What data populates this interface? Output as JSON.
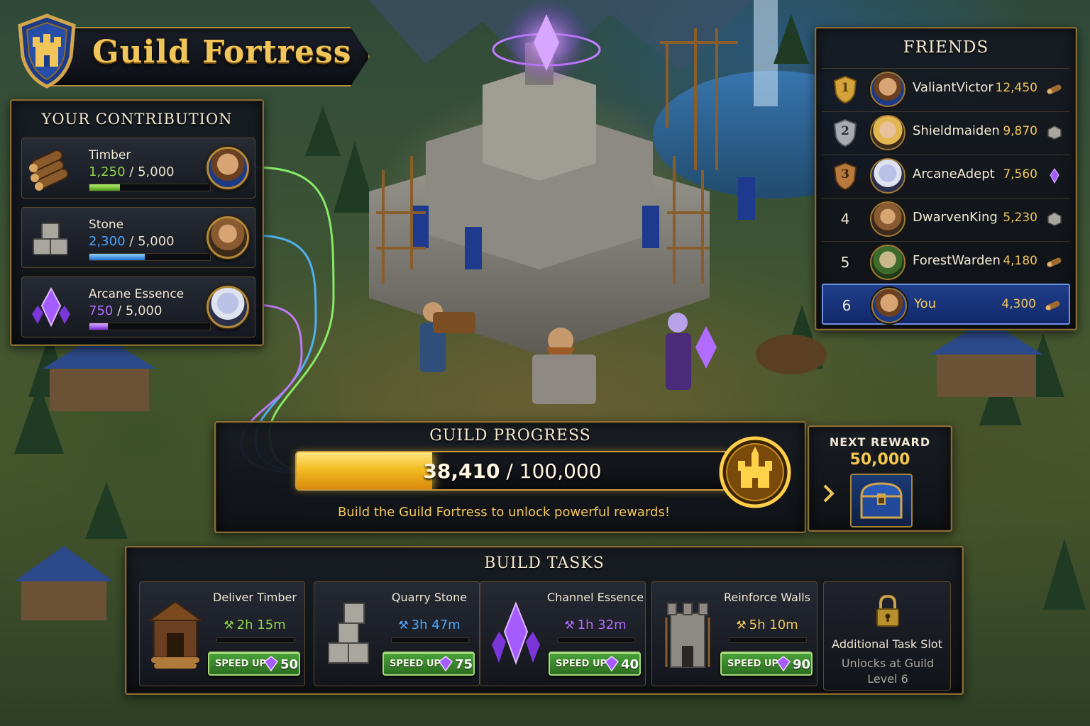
{
  "header": {
    "title": "Guild Fortress",
    "icon": "castle-shield-icon"
  },
  "contribution": {
    "title": "YOUR CONTRIBUTION",
    "resources": [
      {
        "name": "Timber",
        "current": "1,250",
        "separator": "/",
        "max": "5,000",
        "progress": 0.25,
        "color": "#8fd14a",
        "icon": "timber-logs-icon"
      },
      {
        "name": "Stone",
        "current": "2,300",
        "separator": "/",
        "max": "5,000",
        "progress": 0.46,
        "color": "#4aa8ff",
        "icon": "stone-blocks-icon"
      },
      {
        "name": "Arcane Essence",
        "current": "750",
        "separator": "/",
        "max": "5,000",
        "progress": 0.15,
        "color": "#b26bff",
        "icon": "arcane-crystal-icon"
      }
    ]
  },
  "friends": {
    "title": "FRIENDS",
    "list": [
      {
        "rank": "1",
        "name": "ValiantVictor",
        "score": "12,450",
        "resource_icon": "timber-icon",
        "badge": "gold-rank-badge-icon"
      },
      {
        "rank": "2",
        "name": "Shieldmaiden",
        "score": "9,870",
        "resource_icon": "stone-icon",
        "badge": "silver-rank-badge-icon"
      },
      {
        "rank": "3",
        "name": "ArcaneAdept",
        "score": "7,560",
        "resource_icon": "crystal-icon",
        "badge": "bronze-rank-badge-icon"
      },
      {
        "rank": "4",
        "name": "DwarvenKing",
        "score": "5,230",
        "resource_icon": "stone-icon"
      },
      {
        "rank": "5",
        "name": "ForestWarden",
        "score": "4,180",
        "resource_icon": "timber-icon"
      },
      {
        "rank": "6",
        "name": "You",
        "score": "4,300",
        "resource_icon": "timber-icon",
        "highlight": true
      }
    ]
  },
  "guild_progress": {
    "title": "GUILD PROGRESS",
    "current": "38,410",
    "separator": "/",
    "max": "100,000",
    "progress": 0.3841,
    "subtitle": "Build the Guild Fortress to unlock powerful rewards!",
    "medal_icon": "golden-castle-medal-icon"
  },
  "next_reward": {
    "label": "NEXT REWARD",
    "value": "50,000",
    "icon": "treasure-chest-icon"
  },
  "build_tasks": {
    "title": "BUILD TASKS",
    "tasks": [
      {
        "name": "Deliver Timber",
        "time": "2h 15m",
        "time_color": "#8fd14a",
        "speed_label": "SPEED UP",
        "cost": "50",
        "icon": "lumber-shed-icon"
      },
      {
        "name": "Quarry Stone",
        "time": "3h 47m",
        "time_color": "#4aa8ff",
        "speed_label": "SPEED UP",
        "cost": "75",
        "icon": "stone-pile-icon"
      },
      {
        "name": "Channel Essence",
        "time": "1h 32m",
        "time_color": "#b26bff",
        "speed_label": "SPEED UP",
        "cost": "40",
        "icon": "crystal-cluster-icon"
      },
      {
        "name": "Reinforce Walls",
        "time": "5h 10m",
        "time_color": "#f1c75c",
        "speed_label": "SPEED UP",
        "cost": "90",
        "icon": "stone-tower-icon"
      }
    ],
    "locked_slot": {
      "title": "Additional Task Slot",
      "subtitle": "Unlocks at Guild Level 6",
      "icon": "padlock-icon"
    }
  }
}
